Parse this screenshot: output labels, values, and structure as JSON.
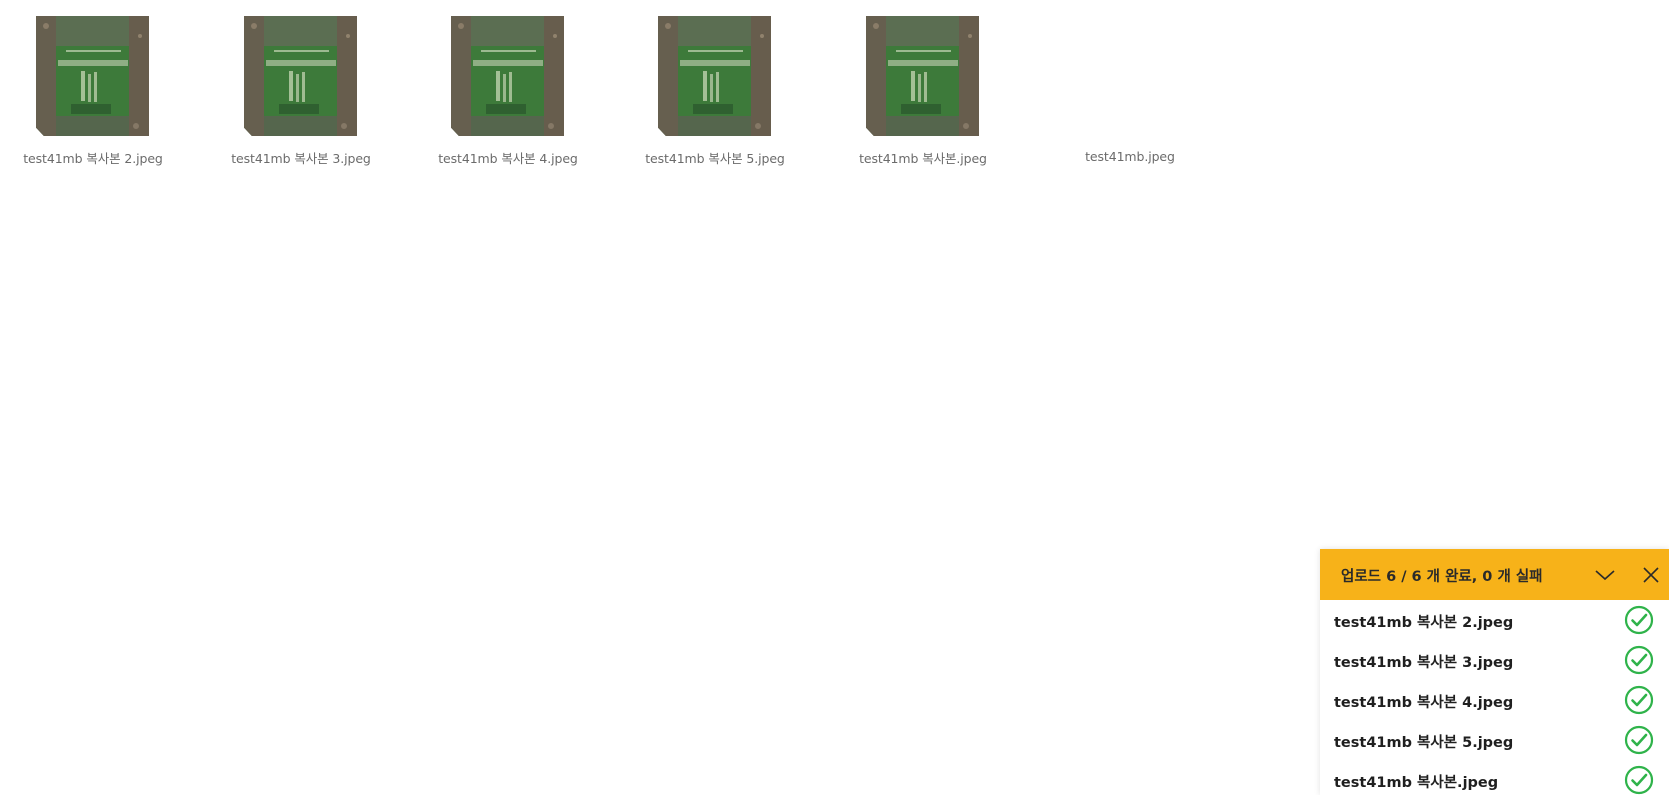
{
  "files": [
    {
      "name": "test41mb 복사본 2.jpeg",
      "thumbnail": "aerial-photo"
    },
    {
      "name": "test41mb 복사본 3.jpeg",
      "thumbnail": "aerial-photo"
    },
    {
      "name": "test41mb 복사본 4.jpeg",
      "thumbnail": "aerial-photo"
    },
    {
      "name": "test41mb 복사본 5.jpeg",
      "thumbnail": "aerial-photo"
    },
    {
      "name": "test41mb 복사본.jpeg",
      "thumbnail": "aerial-photo"
    },
    {
      "name": "test41mb.jpeg",
      "thumbnail": "none"
    }
  ],
  "upload_panel": {
    "title": "업로드 6 / 6 개 완료, 0 개 실패",
    "header_color": "#f7b219",
    "collapse_icon": "chevron-down-icon",
    "close_icon": "close-icon",
    "items": [
      {
        "name": "test41mb 복사본 2.jpeg",
        "status": "complete"
      },
      {
        "name": "test41mb 복사본 3.jpeg",
        "status": "complete"
      },
      {
        "name": "test41mb 복사본 4.jpeg",
        "status": "complete"
      },
      {
        "name": "test41mb 복사본 5.jpeg",
        "status": "complete"
      },
      {
        "name": "test41mb 복사본.jpeg",
        "status": "complete"
      }
    ],
    "status_color": "#2fb34a"
  }
}
